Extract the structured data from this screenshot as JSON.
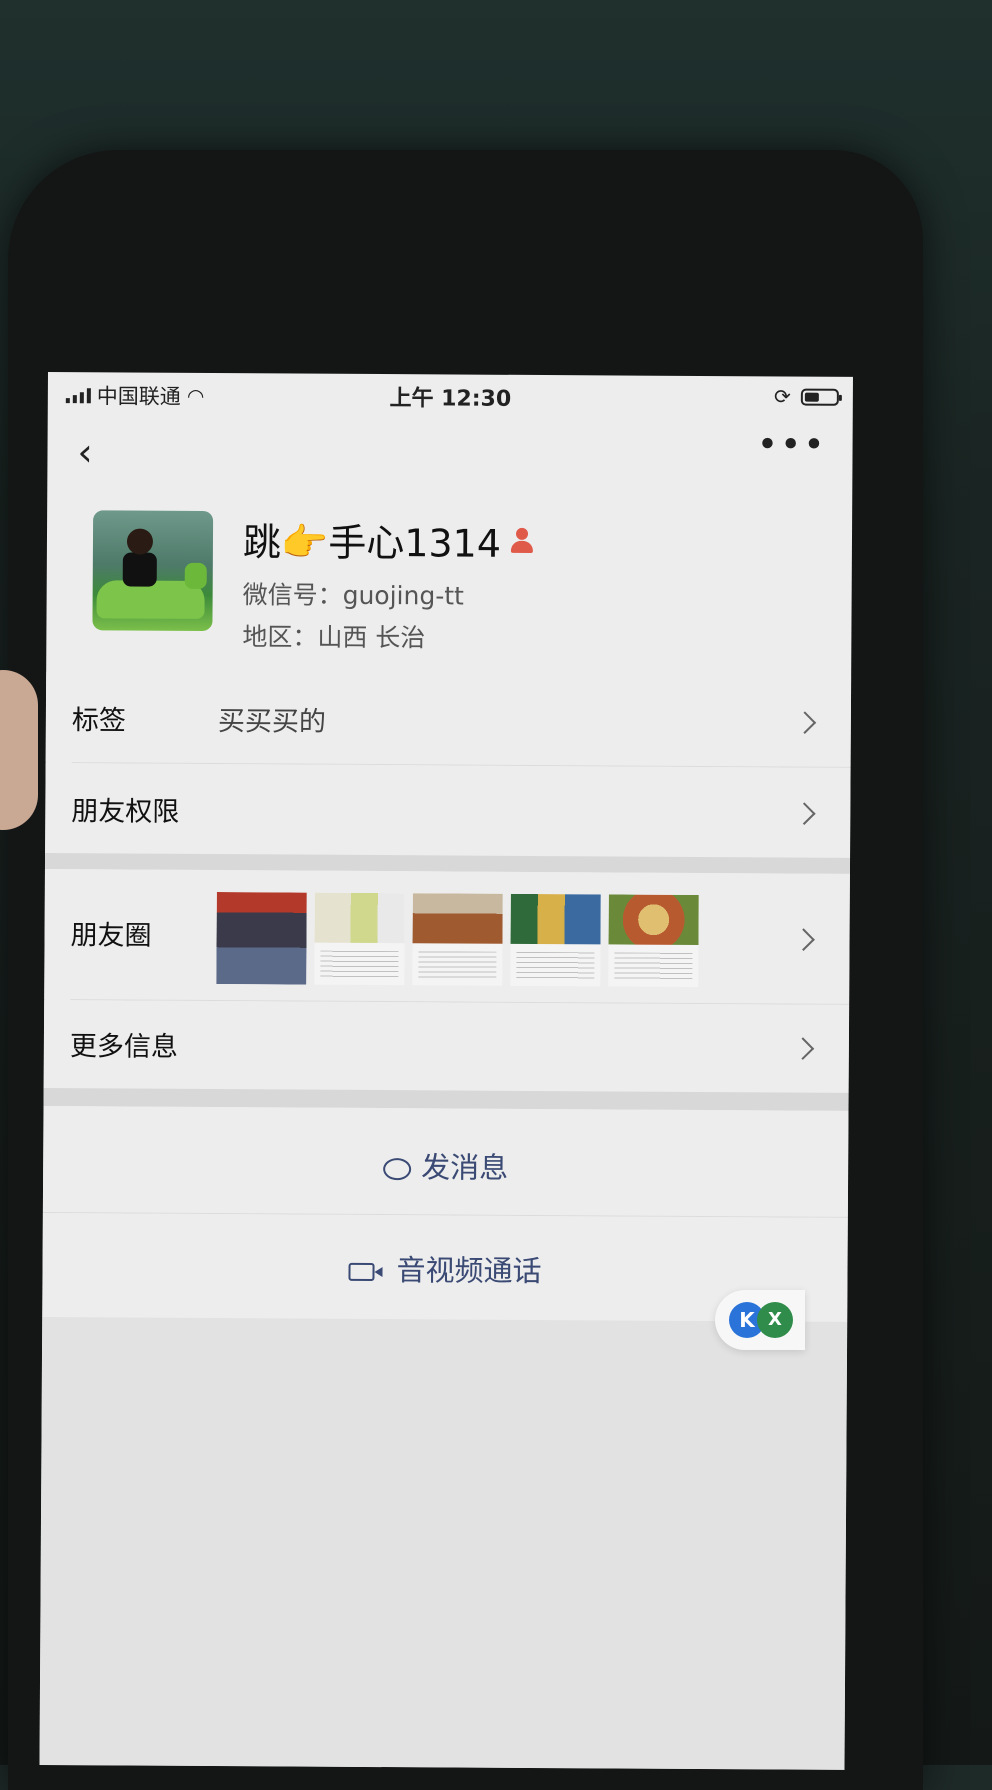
{
  "status_bar": {
    "carrier": "中国联通",
    "time": "上午 12:30",
    "battery_level": 0.45
  },
  "nav": {
    "back_icon": "chevron-left-icon",
    "more_label": "•••"
  },
  "profile": {
    "name": "跳👉手心1314",
    "wechat_id": "微信号：guojing-tt",
    "region": "地区：山西 长治"
  },
  "rows": {
    "tags": {
      "label": "标签",
      "value": "买买买的"
    },
    "friend_permissions": {
      "label": "朋友权限"
    },
    "moments": {
      "label": "朋友圈"
    },
    "more_info": {
      "label": "更多信息"
    }
  },
  "actions": {
    "send_message": "发消息",
    "av_call": "音视频通话"
  },
  "floating": {
    "btn1": "K",
    "btn2": "X"
  },
  "colors": {
    "accent": "#3a4a74",
    "background": "#ededed"
  }
}
